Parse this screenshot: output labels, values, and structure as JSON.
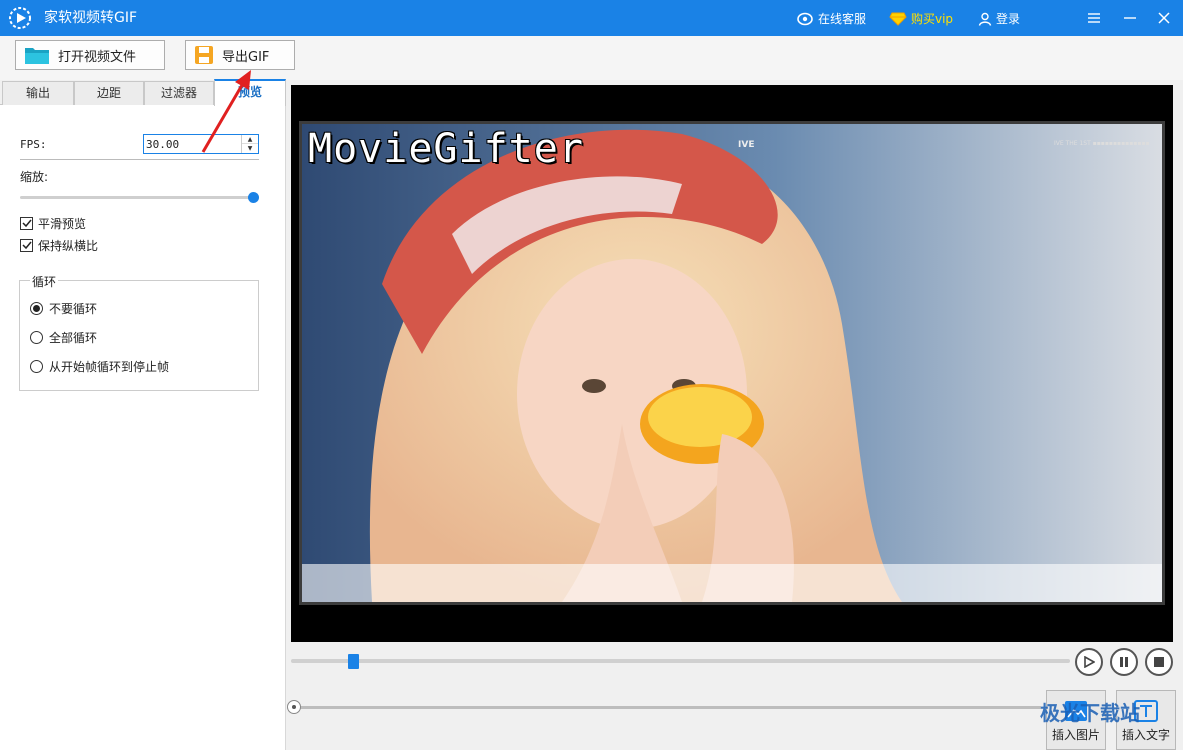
{
  "titlebar": {
    "title": "家软视频转GIF",
    "service_label": "在线客服",
    "vip_label": "购买vip",
    "login_label": "登录",
    "accent": "#1a82e6"
  },
  "toolbar": {
    "open_label": "打开视频文件",
    "export_label": "导出GIF"
  },
  "tabs": [
    {
      "label": "输出"
    },
    {
      "label": "边距"
    },
    {
      "label": "过滤器"
    },
    {
      "label": "预览",
      "active": true
    }
  ],
  "preview": {
    "fps_label": "FPS:",
    "fps_value": "30.00",
    "zoom_label": "缩放:",
    "zoom_level": 1.0,
    "smooth_label": "平滑预览",
    "smooth_checked": true,
    "ratio_label": "保持纵横比",
    "ratio_checked": true,
    "loop": {
      "title": "循环",
      "options": [
        {
          "label": "不要循环",
          "selected": true
        },
        {
          "label": "全部循环",
          "selected": false
        },
        {
          "label": "从开始帧循环到停止帧",
          "selected": false
        }
      ]
    }
  },
  "video": {
    "watermark": "MovieGifter",
    "overlay_left": "IVE",
    "overlay_right": "IVE THE 1ST ▪▪▪▪▪▪▪▪▪▪▪▪▪▪",
    "timeline_position": 0.08
  },
  "bottom": {
    "insert_image_label": "插入图片",
    "insert_text_label": "插入文字",
    "site_watermark": "极光下载站"
  },
  "icons": {
    "logo": "app-logo-icon",
    "service": "headset-icon",
    "vip": "diamond-icon",
    "login": "user-icon",
    "menu": "menu-icon",
    "minimize": "minimize-icon",
    "close": "close-icon",
    "open": "folder-icon",
    "export": "save-icon",
    "play": "play-icon",
    "pause": "pause-icon",
    "stop": "stop-icon"
  }
}
